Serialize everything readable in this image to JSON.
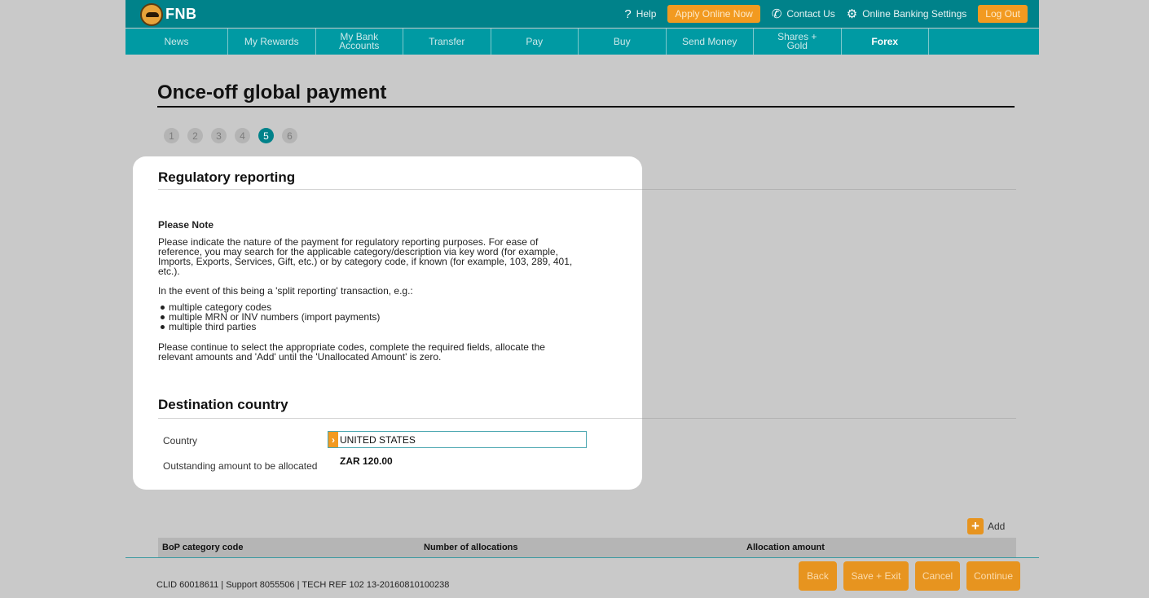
{
  "header": {
    "brand": "FNB",
    "help": "Help",
    "apply_online": "Apply Online Now",
    "contact_us": "Contact Us",
    "banking_settings": "Online Banking Settings",
    "log_out": "Log Out"
  },
  "nav": {
    "items": [
      "News",
      "My Rewards",
      "My Bank\nAccounts",
      "Transfer",
      "Pay",
      "Buy",
      "Send Money",
      "Shares +\nGold",
      "Forex"
    ]
  },
  "page": {
    "title": "Once-off global payment",
    "steps": [
      "1",
      "2",
      "3",
      "4",
      "5",
      "6"
    ],
    "active_step": "5"
  },
  "regulatory": {
    "heading": "Regulatory reporting",
    "note_heading": "Please Note",
    "paragraph1": "Please indicate the nature of the payment for regulatory reporting purposes. For ease of reference, you may search for the applicable category/description via key word (for example, Imports, Exports, Services, Gift, etc.) or by category code, if known (for example, 103, 289, 401, etc.).",
    "paragraph2": "In the event of this being a 'split reporting' transaction, e.g.:",
    "bullets": [
      "multiple category codes",
      "multiple MRN or INV numbers (import payments)",
      "multiple third parties"
    ],
    "paragraph3": "Please continue to select the appropriate codes, complete the required fields, allocate the relevant amounts and 'Add' until the 'Unallocated Amount' is zero."
  },
  "destination": {
    "heading": "Destination country",
    "country_label": "Country",
    "country_value": "UNITED STATES",
    "outstanding_label": "Outstanding amount to be allocated",
    "outstanding_value": "ZAR 120.00"
  },
  "allocations": {
    "add_label": "Add",
    "columns": [
      "BoP category code",
      "Number of allocations",
      "Allocation amount"
    ]
  },
  "footer": {
    "text": "CLID 60018611 | Support 8055506 | TECH REF 102 13-20160810100238",
    "buttons": [
      "Back",
      "Save + Exit",
      "Cancel",
      "Continue"
    ]
  },
  "colors": {
    "teal_dark": "#00828a",
    "teal": "#009aa3",
    "orange": "#f29a20",
    "overlay_grey": "#c9c9c9"
  }
}
